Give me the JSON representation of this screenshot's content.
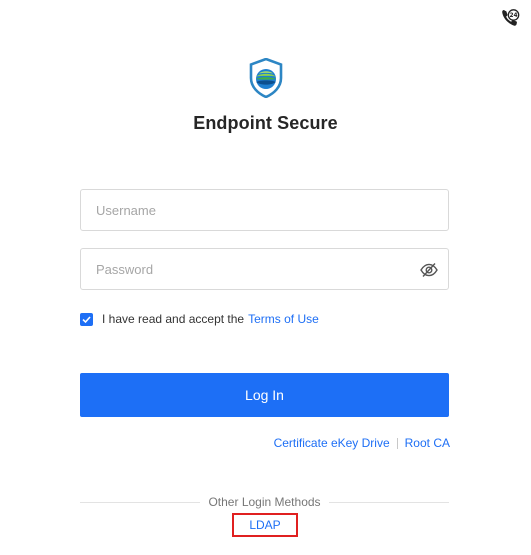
{
  "header": {
    "support_icon": "phone-24-icon"
  },
  "brand": {
    "logo_icon": "shield-logo-icon",
    "title": "Endpoint Secure"
  },
  "form": {
    "username_placeholder": "Username",
    "password_placeholder": "Password",
    "password_toggle_icon": "eye-off-icon",
    "terms_checked": true,
    "terms_text": "I have read and accept the",
    "terms_link": "Terms of Use",
    "login_label": "Log In"
  },
  "links": {
    "certificate": "Certificate eKey Drive",
    "root_ca": "Root CA"
  },
  "other_methods": {
    "title": "Other Login Methods",
    "ldap_label": "LDAP"
  },
  "colors": {
    "primary": "#1d6ff6",
    "highlight_border": "#e02020"
  }
}
